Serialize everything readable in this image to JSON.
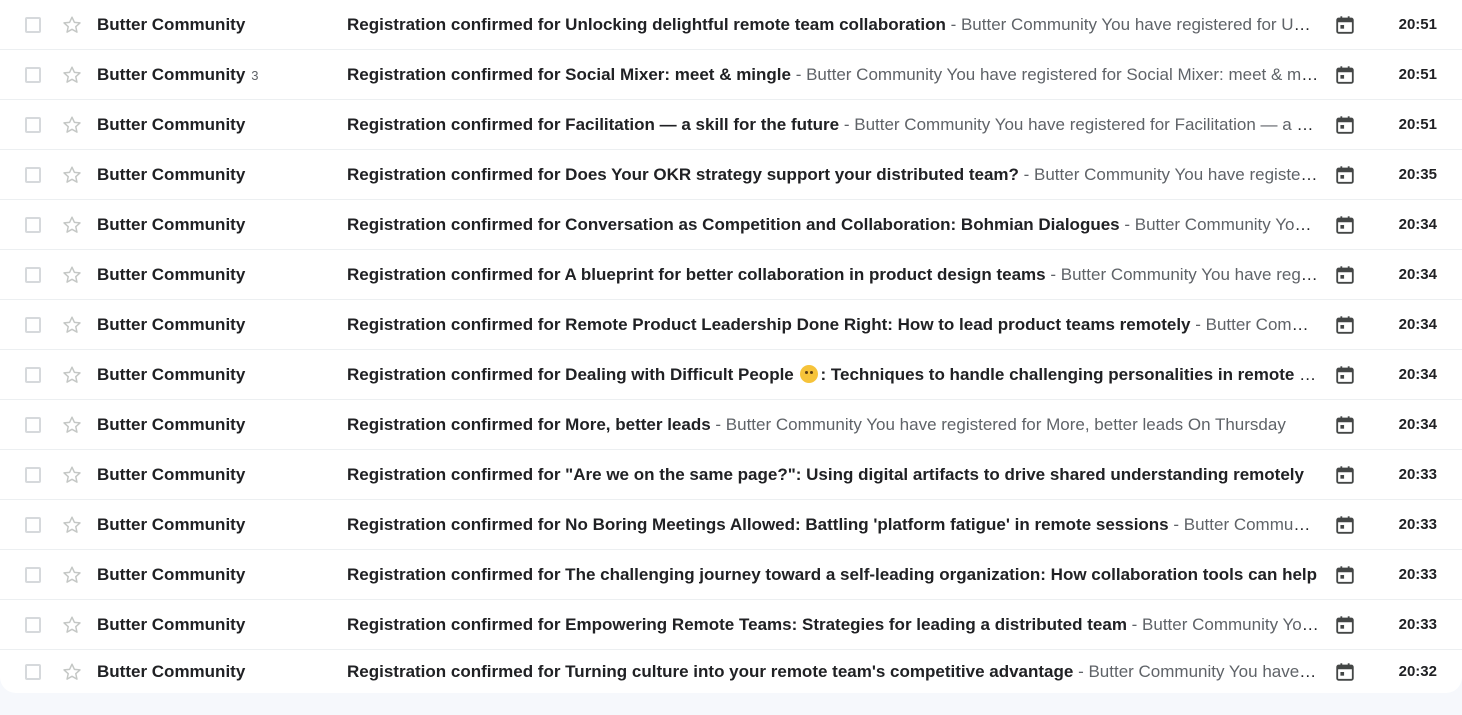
{
  "inbox": {
    "rows": [
      {
        "sender": "Butter Community",
        "count": "",
        "subject": "Registration confirmed for Unlocking delightful remote team collaboration",
        "snippet": " - Butter Community You have registered for Unlocking delightful remote team collaboration",
        "time": "20:51",
        "icon": "calendar-icon"
      },
      {
        "sender": "Butter Community",
        "count": "3",
        "subject": "Registration confirmed for Social Mixer: meet & mingle",
        "snippet": " - Butter Community You have registered for Social Mixer: meet & mingle",
        "time": "20:51",
        "icon": "calendar-icon"
      },
      {
        "sender": "Butter Community",
        "count": "",
        "subject": "Registration confirmed for Facilitation — a skill for the future",
        "snippet": " - Butter Community You have registered for Facilitation — a skill for the future",
        "time": "20:51",
        "icon": "calendar-icon"
      },
      {
        "sender": "Butter Community",
        "count": "",
        "subject": "Registration confirmed for Does Your OKR strategy support your distributed team?",
        "snippet": " - Butter Community You have registered",
        "time": "20:35",
        "icon": "calendar-icon"
      },
      {
        "sender": "Butter Community",
        "count": "",
        "subject": "Registration confirmed for Conversation as Competition and Collaboration: Bohmian Dialogues",
        "snippet": " - Butter Community You have registered",
        "time": "20:34",
        "icon": "calendar-icon"
      },
      {
        "sender": "Butter Community",
        "count": "",
        "subject": "Registration confirmed for A blueprint for better collaboration in product design teams",
        "snippet": " - Butter Community You have registered",
        "time": "20:34",
        "icon": "calendar-icon"
      },
      {
        "sender": "Butter Community",
        "count": "",
        "subject": "Registration confirmed for Remote Product Leadership Done Right: How to lead product teams remotely",
        "snippet": " - Butter Community You have registered",
        "time": "20:34",
        "icon": "calendar-icon"
      },
      {
        "sender": "Butter Community",
        "count": "",
        "subject_pre": "Registration confirmed for Dealing with Difficult People ",
        "subject_post": ": Techniques to handle challenging personalities in remote teams",
        "has_emoji": true,
        "emoji": "shushing-face-emoji",
        "snippet": "",
        "time": "20:34",
        "icon": "calendar-icon"
      },
      {
        "sender": "Butter Community",
        "count": "",
        "subject": "Registration confirmed for More, better leads",
        "snippet": " - Butter Community You have registered for More, better leads On Thursday",
        "time": "20:34",
        "icon": "calendar-icon"
      },
      {
        "sender": "Butter Community",
        "count": "",
        "subject": "Registration confirmed for \"Are we on the same page?\": Using digital artifacts to drive shared understanding remotely",
        "snippet": "",
        "time": "20:33",
        "icon": "calendar-icon"
      },
      {
        "sender": "Butter Community",
        "count": "",
        "subject": "Registration confirmed for No Boring Meetings Allowed: Battling 'platform fatigue' in remote sessions",
        "snippet": " - Butter Community You have registered",
        "time": "20:33",
        "icon": "calendar-icon"
      },
      {
        "sender": "Butter Community",
        "count": "",
        "subject": "Registration confirmed for The challenging journey toward a self-leading organization: How collaboration tools can help",
        "snippet": "",
        "time": "20:33",
        "icon": "calendar-icon"
      },
      {
        "sender": "Butter Community",
        "count": "",
        "subject": "Registration confirmed for Empowering Remote Teams: Strategies for leading a distributed team",
        "snippet": " - Butter Community You have registered",
        "time": "20:33",
        "icon": "calendar-icon"
      },
      {
        "sender": "Butter Community",
        "count": "",
        "subject": "Registration confirmed for Turning culture into your remote team's competitive advantage",
        "snippet": " - Butter Community You have registered",
        "time": "20:32",
        "icon": "calendar-icon"
      }
    ]
  },
  "colors": {
    "background": "#f6f8fc",
    "text": "#202124",
    "muted": "#5f6368",
    "divider": "#eceff1"
  }
}
